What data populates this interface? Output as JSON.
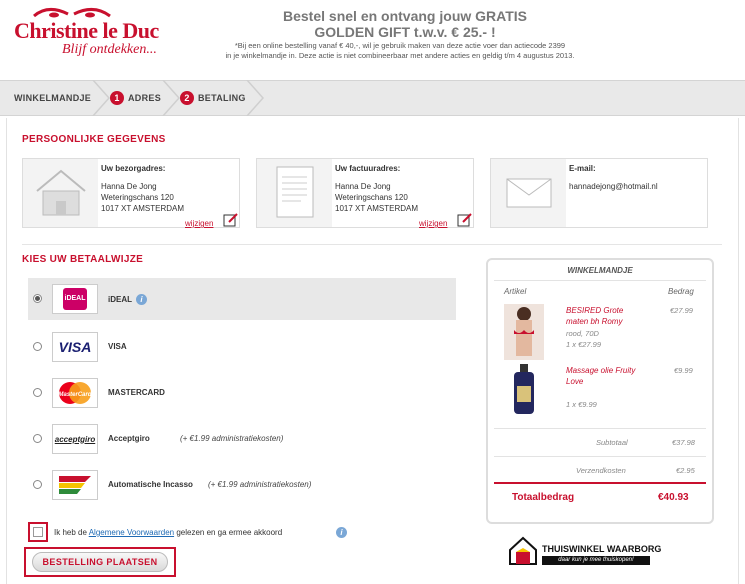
{
  "brand": {
    "name": "Christine le Duc",
    "tagline": "Blijf ontdekken..."
  },
  "promo": {
    "line1": "Bestel snel en ontvang jouw GRATIS",
    "line2": "GOLDEN GIFT t.w.v. € 25.- !",
    "fine1": "*Bij een online bestelling vanaf € 40,-, wil je gebruik maken van deze actie voer dan actiecode 2399",
    "fine2": "in je winkelmandje in. Deze actie is niet combineerbaar met andere acties en geldig t/m 4 augustus 2013."
  },
  "steps": [
    {
      "label": "WINKELMANDJE",
      "num": ""
    },
    {
      "label": "ADRES",
      "num": "1"
    },
    {
      "label": "BETALING",
      "num": "2"
    }
  ],
  "personal": {
    "title": "PERSOONLIJKE GEGEVENS",
    "delivery": {
      "heading": "Uw bezorgadres:",
      "name": "Hanna De Jong",
      "street": "Weteringschans 120",
      "city": "1017 XT AMSTERDAM",
      "edit": "wijzigen"
    },
    "invoice": {
      "heading": "Uw factuuradres:",
      "name": "Hanna De Jong",
      "street": "Weteringschans 120",
      "city": "1017 XT AMSTERDAM",
      "edit": "wijzigen"
    },
    "email": {
      "heading": "E-mail:",
      "value": "hannadejong@hotmail.nl"
    }
  },
  "payment": {
    "title": "KIES UW BETAALWIJZE",
    "methods": [
      {
        "name": "iDEAL",
        "note": "",
        "selected": true
      },
      {
        "name": "VISA",
        "note": "",
        "selected": false
      },
      {
        "name": "MASTERCARD",
        "note": "",
        "selected": false
      },
      {
        "name": "Acceptgiro",
        "note": "(+ €1.99 administratiekosten)",
        "selected": false
      },
      {
        "name": "Automatische Incasso",
        "note": "(+ €1.99 administratiekosten)",
        "selected": false
      }
    ],
    "logos": {
      "ideal": "iDEAL",
      "visa": "VISA",
      "mastercard": "MasterCard",
      "acceptgiro": "acceptgiro"
    }
  },
  "cart": {
    "title": "WINKELMANDJE",
    "col_article": "Artikel",
    "col_amount": "Bedrag",
    "items": [
      {
        "name1": "BESIRED Grote",
        "name2": "maten bh Romy",
        "detail": "rood, 70D",
        "qty": "1 x  €27.99",
        "price": "€27.99"
      },
      {
        "name1": "Massage olie Fruity",
        "name2": "Love",
        "detail": "",
        "qty": "1 x  €9.99",
        "price": "€9.99"
      }
    ],
    "subtotal_label": "Subtotaal",
    "subtotal": "€37.98",
    "shipping_label": "Verzendkosten",
    "shipping": "€2.95",
    "total_label": "Totaalbedrag",
    "total": "€40.93"
  },
  "agreement": {
    "pre": "Ik heb de ",
    "link": "Algemene Voorwaarden",
    "post": " gelezen en ga ermee akkoord"
  },
  "order_button": "BESTELLING PLAATSEN",
  "trust": {
    "name": "THUISWINKEL WAARBORG",
    "tagline": "daar kun je mee thuiskopen!"
  },
  "colors": {
    "brand_red": "#c8102e",
    "link_blue": "#1e6ab4",
    "info_blue": "#7aa7d6"
  }
}
